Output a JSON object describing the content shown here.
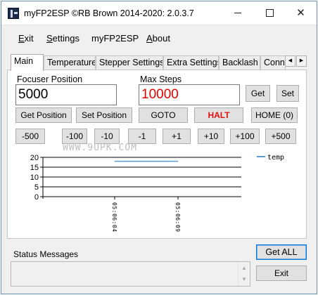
{
  "window": {
    "title": "myFP2ESP ©RB Brown 2014-2020: 2.0.3.7"
  },
  "menu": [
    {
      "label_pre": "",
      "label_u": "E",
      "label_post": "xit"
    },
    {
      "label_pre": "",
      "label_u": "S",
      "label_post": "ettings"
    },
    {
      "label_pre": "myFP2ESP",
      "label_u": "",
      "label_post": ""
    },
    {
      "label_pre": "",
      "label_u": "A",
      "label_post": "bout"
    }
  ],
  "tabs": [
    "Main",
    "Temperature",
    "Stepper Settings",
    "Extra Settings",
    "Backlash",
    "Conn"
  ],
  "main": {
    "focuser_position_label": "Focuser Position",
    "focuser_position_value": "5000",
    "max_steps_label": "Max Steps",
    "max_steps_value": "10000",
    "get_label": "Get",
    "set_label": "Set",
    "get_position_label": "Get Position",
    "set_position_label": "Set Position",
    "goto_label": "GOTO",
    "halt_label": "HALT",
    "home_label": "HOME (0)",
    "step_buttons": [
      "-500",
      "-100",
      "-10",
      "-1",
      "+1",
      "+10",
      "+100",
      "+500"
    ]
  },
  "colors": {
    "accent": "#0078d7",
    "halt": "#e01010",
    "max_steps": "#e00000",
    "series": "#5b9bd5"
  },
  "chart_data": {
    "type": "line",
    "x": [
      "05:06:04",
      "05:06:09"
    ],
    "series": [
      {
        "name": "temp",
        "values": [
          18,
          18
        ]
      }
    ],
    "ylim": [
      0,
      20
    ],
    "yticks": [
      0,
      5,
      10,
      15,
      20
    ],
    "grid": true,
    "legend": "top-right"
  },
  "status": {
    "label": "Status Messages",
    "text": ""
  },
  "footer": {
    "get_all_label": "Get ALL",
    "exit_label": "Exit"
  },
  "watermark": "WWW.9UPK.COM"
}
